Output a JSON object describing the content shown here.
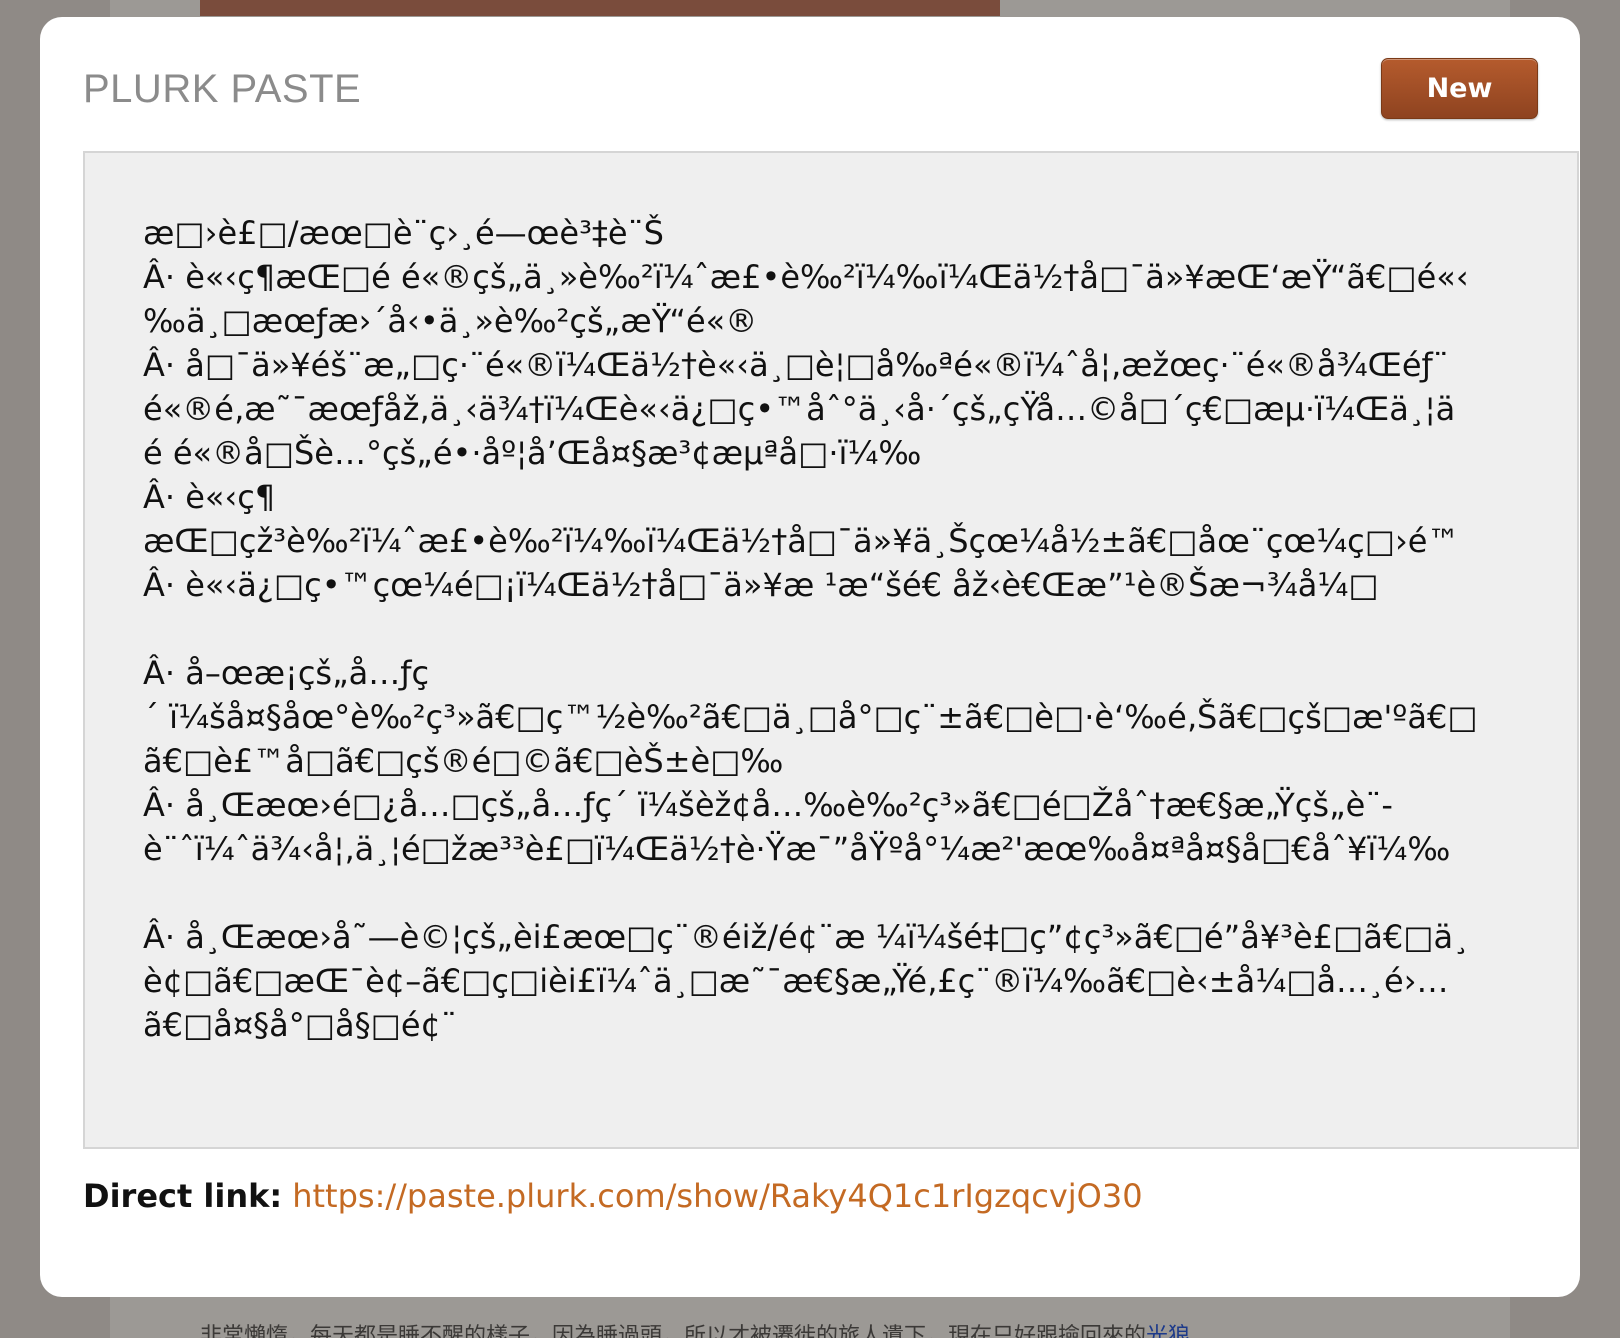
{
  "modal": {
    "title": "PLURK PASTE",
    "new_button_label": "New",
    "paste_text": "æ□›è£□/æœ□è¨ç›¸é—œè³‡è¨Š\nÂ· è«‹ç¶æŒ□é é«®çš„ä¸»è‰²ï¼ˆæ£•è‰²ï¼‰ï¼Œä½†å□¯ä»¥æŒ‘æŸ“ã€□é«‹\n‰ä¸□æœƒæ›´å‹•ä¸»è‰²çš„æŸ“é«®\nÂ· å□¯ä»¥éš¨æ„□ç·¨é«®ï¼Œä½†è«‹ä¸□è¦□å‰ªé«®ï¼ˆå¦‚æžœç·¨é«®å¾Œéƒ¨\né«®é‚æ˜¯æœƒåž‚ä¸‹ä¾†ï¼Œè«‹ä¿□ç•™åˆ°ä¸‹å·´çš„çŸå…©å□´ç€□æµ·ï¼Œä¸¦ä\né é«®å□Šè…°çš„é•·åº¦å’Œå¤§æ³¢æµªå□·ï¼‰\nÂ· è«‹ç¶­\næŒ□çž³è‰²ï¼ˆæ£•è‰²ï¼‰ï¼Œä½†å□¯ä»¥ä¸Šçœ¼å½±ã€□åœ¨çœ¼ç□›é™\nÂ· è«‹ä¿□ç•™çœ¼é□¡ï¼Œä½†å□¯ä»¥æ ¹æ“šé€ åž‹è€Œæ”¹è®Šæ¬¾å¼□\n\nÂ· å–œæ¡çš„å…ƒç\n´ ï¼šå¤§åœ°è‰²ç³»ã€□ç™½è‰²ã€□ä¸□å°□ç¨±ã€□è□·è‘‰é‚Šã€□çš□æ'ºã€□\nã€□è£™å□ã€□çš®é□©ã€□èŠ±è□‰\nÂ· å¸Œæœ›é□¿å…□çš„å…ƒç´ ï¼šèž¢å…‰è‰²ç³»ã€□é□Žåˆ†æ€§æ„Ÿçš„è¨-\nè¨ˆï¼ˆä¾‹å¦‚ä¸¦é□žæ³³è£□ï¼Œä½†è·Ÿæ¯”åŸºå°¼æ²'æœ‰å¤ªå¤§å□€åˆ¥ï¼‰\n\nÂ· å¸Œæœ›å˜—è©¦çš„èi£æœ□ç¨®éiž/é¢¨æ ¼ï¼šé‡□ç”¢ç³»ã€□é”å¥³è£□ã€□ä¸\nè¢□ã€□æŒ¯è¢–ã€□ç□ièi£ï¼ˆä¸□æ˜¯æ€§æ„Ÿé‚£ç¨®ï¼‰ã€□è‹±å¼□å…¸é›…\nã€□å¤§å°□å§□é¢¨",
    "direct_link_label": "Direct link:",
    "direct_link_url": "https://paste.plurk.com/show/Raky4Q1c1rIgzqcvjO30"
  },
  "background": {
    "bottom_text": "非常懶惰，每天都是睡不醒的樣子，因為睡過頭，所以才被遷徙的旅人遺下，現在只好跟撿回來的",
    "bottom_link": "光狼"
  },
  "colors": {
    "button_bg": "#a04e25",
    "link": "#c46a23",
    "paste_bg": "#efefef",
    "title": "#8b8b8b"
  }
}
